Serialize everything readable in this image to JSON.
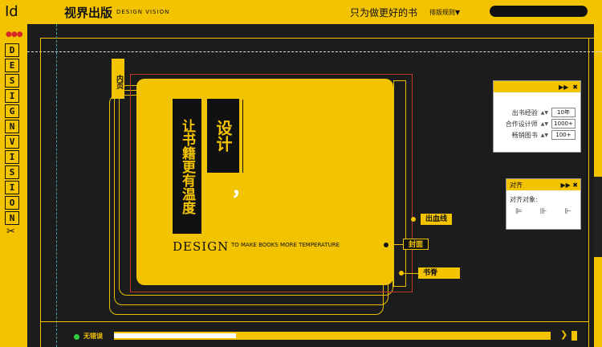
{
  "header": {
    "app_id": "Id",
    "brand_cn": "视界出版",
    "brand_en": "DESIGN  VISION",
    "slogan": "只为做更好的书",
    "layout_menu": "排版规则",
    "search_placeholder": ""
  },
  "sidebar": {
    "letters": [
      "D",
      "E",
      "S",
      "I",
      "G",
      "N",
      "V",
      "I",
      "S",
      "I",
      "O",
      "N"
    ]
  },
  "artboard": {
    "inner_label": "内页",
    "title_line1": "让书籍更有温度",
    "title_line2": "设计",
    "comma": "，",
    "design_word": "DESIGN",
    "design_tagline": "TO MAKE BOOKS MORE TEMPERATURE",
    "markers": {
      "bleed": "出血线",
      "cover": "封面",
      "spine": "书脊"
    }
  },
  "stats_panel": {
    "rows": [
      {
        "label": "出书经验",
        "value": "10年"
      },
      {
        "label": "合作设计师",
        "value": "1000+"
      },
      {
        "label": "畅销图书",
        "value": "100+"
      }
    ]
  },
  "align_panel": {
    "title": "对齐",
    "subtitle": "对齐对象:"
  },
  "status": {
    "text": "无错误",
    "progress": 0.28
  },
  "colors": {
    "accent": "#f4c300",
    "ok": "#2ecc40",
    "bleed": "#c0392b"
  }
}
